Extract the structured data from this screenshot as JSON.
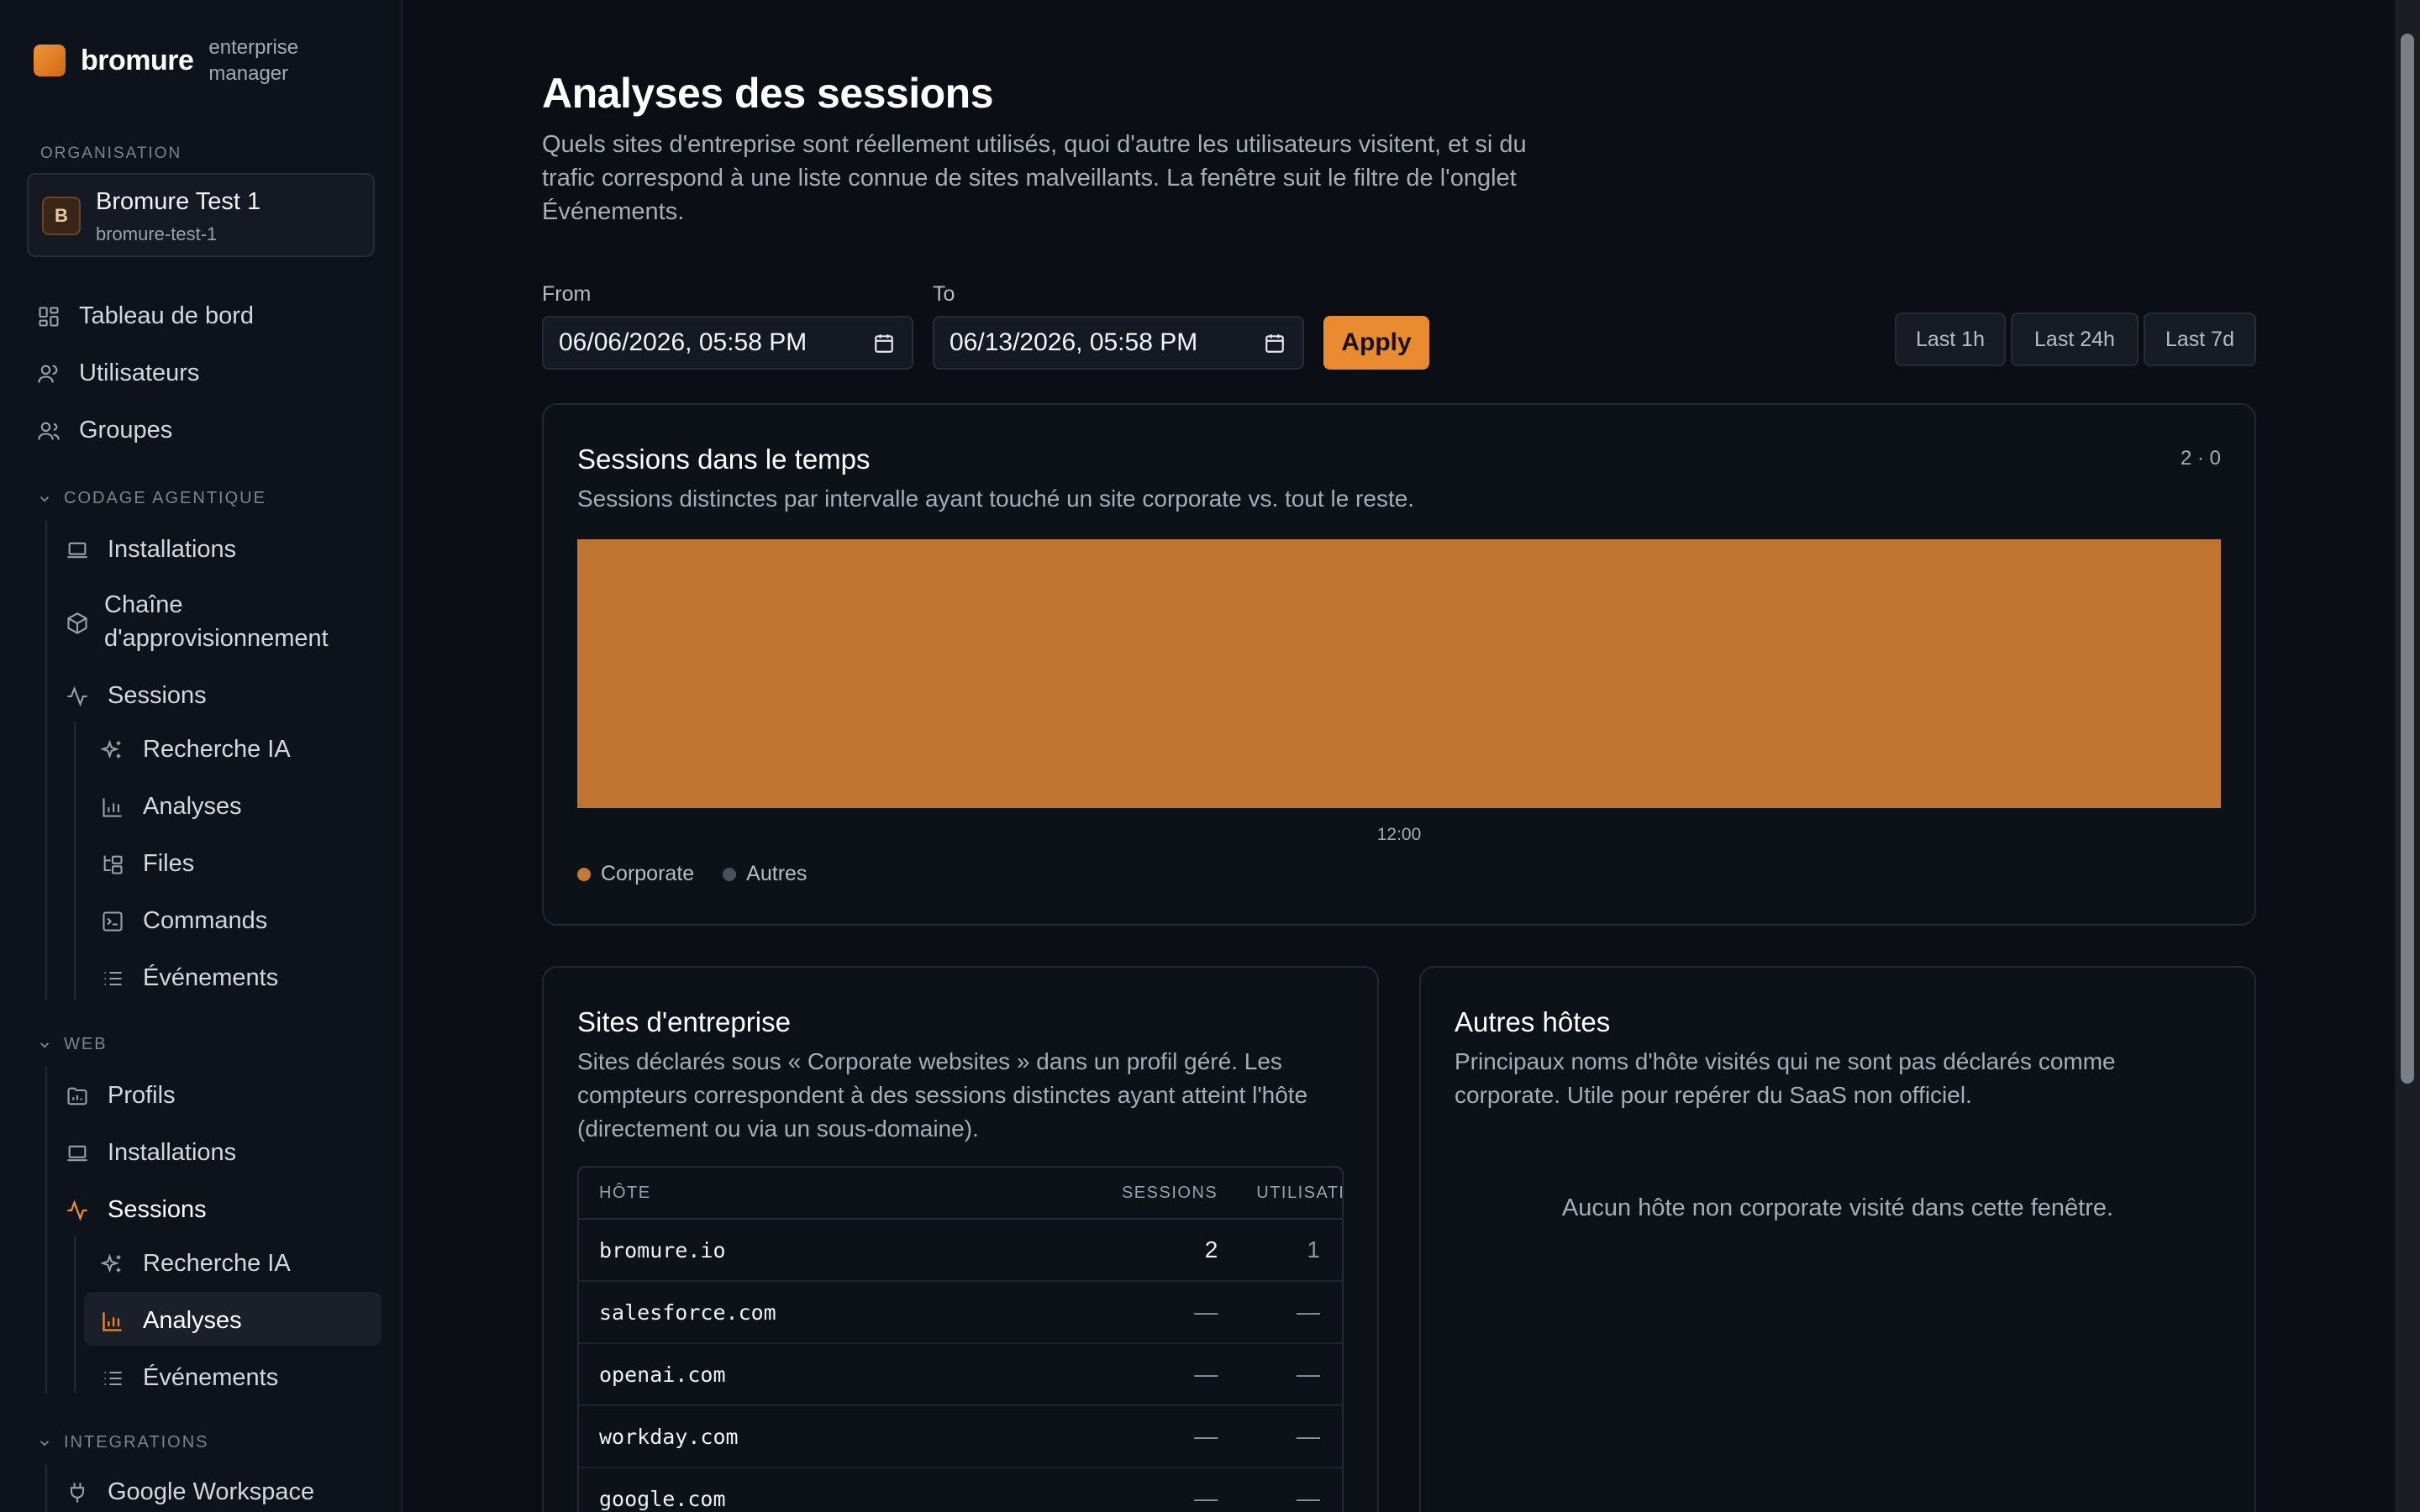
{
  "brand": {
    "name": "bromure",
    "subtitle": "enterprise manager"
  },
  "sidebar": {
    "org_section_label": "ORGANISATION",
    "org": {
      "initial": "B",
      "name": "Bromure Test 1",
      "slug": "bromure-test-1"
    },
    "top_items": [
      {
        "label": "Tableau de bord",
        "icon": "dashboard-icon"
      },
      {
        "label": "Utilisateurs",
        "icon": "user-icon"
      },
      {
        "label": "Groupes",
        "icon": "users-icon"
      }
    ],
    "groups": [
      {
        "label": "CODAGE AGENTIQUE",
        "items": [
          {
            "label": "Installations",
            "icon": "laptop-icon"
          },
          {
            "label": "Chaîne d'approvisionnement",
            "icon": "package-icon"
          },
          {
            "label": "Sessions",
            "icon": "activity-icon"
          }
        ],
        "sub_items": [
          {
            "label": "Recherche IA",
            "icon": "sparkles-icon"
          },
          {
            "label": "Analyses",
            "icon": "bar-chart-icon"
          },
          {
            "label": "Files",
            "icon": "folder-tree-icon"
          },
          {
            "label": "Commands",
            "icon": "terminal-icon"
          },
          {
            "label": "Événements",
            "icon": "list-icon"
          }
        ]
      },
      {
        "label": "WEB",
        "items": [
          {
            "label": "Profils",
            "icon": "folder-chart-icon"
          },
          {
            "label": "Installations",
            "icon": "laptop-icon"
          },
          {
            "label": "Sessions",
            "icon": "activity-icon",
            "active": true
          }
        ],
        "sub_items": [
          {
            "label": "Recherche IA",
            "icon": "sparkles-icon"
          },
          {
            "label": "Analyses",
            "icon": "bar-chart-icon",
            "active": true
          },
          {
            "label": "Événements",
            "icon": "list-icon"
          }
        ]
      },
      {
        "label": "INTEGRATIONS",
        "items": [
          {
            "label": "Google Workspace",
            "icon": "plug-icon"
          }
        ]
      }
    ]
  },
  "page": {
    "title": "Analyses des sessions",
    "description": "Quels sites d'entreprise sont réellement utilisés, quoi d'autre les utilisateurs visitent, et si du trafic correspond à une liste connue de sites malveillants. La fenêtre suit le filtre de l'onglet Événements."
  },
  "filters": {
    "from_label": "From",
    "from_value": "06/06/2026, 05:58 PM",
    "to_label": "To",
    "to_value": "06/13/2026, 05:58 PM",
    "apply_label": "Apply",
    "ranges": [
      "Last 1h",
      "Last 24h",
      "Last 7d"
    ]
  },
  "sessions_card": {
    "title": "Sessions dans le temps",
    "description": "Sessions distinctes par intervalle ayant touché un site corporate vs. tout le reste.",
    "count": "2 · 0"
  },
  "chart_data": {
    "type": "bar",
    "categories": [
      "12:00"
    ],
    "series": [
      {
        "name": "Corporate",
        "values": [
          2
        ],
        "color": "#bf752f"
      },
      {
        "name": "Autres",
        "values": [
          0
        ],
        "color": "#4a4f58"
      }
    ],
    "ylim": [
      0,
      2
    ],
    "legend": "bottom-left",
    "grid": false
  },
  "corporate_card": {
    "title": "Sites d'entreprise",
    "description": "Sites déclarés sous « Corporate websites » dans un profil géré. Les compteurs correspondent à des sessions distinctes ayant atteint l'hôte (directement ou via un sous-domaine).",
    "columns": [
      "HÔTE",
      "SESSIONS",
      "UTILISATEURS"
    ],
    "rows": [
      {
        "host": "bromure.io",
        "sessions": "2",
        "users": "1"
      },
      {
        "host": "salesforce.com",
        "sessions": "—",
        "users": "—"
      },
      {
        "host": "openai.com",
        "sessions": "—",
        "users": "—"
      },
      {
        "host": "workday.com",
        "sessions": "—",
        "users": "—"
      },
      {
        "host": "google.com",
        "sessions": "—",
        "users": "—"
      }
    ]
  },
  "other_hosts_card": {
    "title": "Autres hôtes",
    "description": "Principaux noms d'hôte visités qui ne sont pas déclarés comme corporate. Utile pour repérer du SaaS non officiel.",
    "empty": "Aucun hôte non corporate visité dans cette fenêtre."
  }
}
